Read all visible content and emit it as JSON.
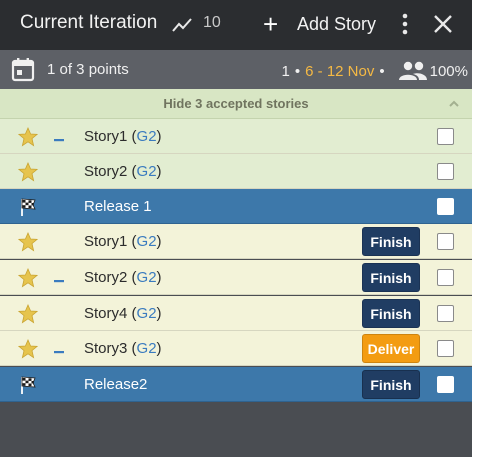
{
  "header": {
    "title": "Current Iteration",
    "velocity": "10",
    "add_story_label": "Add Story",
    "icons": {
      "velocity": "trend-line-icon",
      "add": "plus-icon",
      "more": "more-vertical-icon",
      "close": "close-icon"
    }
  },
  "subheader": {
    "points": "1 of 3 points",
    "iteration_number": "1",
    "separator": "•",
    "dates": "6 - 12 Nov",
    "team_strength": "100%",
    "icons": {
      "calendar": "calendar-icon",
      "team": "team-icon"
    }
  },
  "accepted_bar": {
    "label": "Hide 3 accepted stories"
  },
  "colors": {
    "header_bg": "#2b2d30",
    "subheader_bg": "#5d6066",
    "accepted_bg": "#e2edd1",
    "current_bg": "#f3f3d9",
    "release_bg": "#3d78aa",
    "finish_button": "#203d63",
    "deliver_button": "#f39c12",
    "date_accent": "#f5b944",
    "label_link": "#3a7bbf"
  },
  "stories": [
    {
      "type": "feature",
      "state": "accepted",
      "title": "Story1",
      "label": "G2",
      "has_estimate_mark": true,
      "action": ""
    },
    {
      "type": "feature",
      "state": "accepted",
      "title": "Story2",
      "label": "G2",
      "has_estimate_mark": false,
      "action": ""
    },
    {
      "type": "release",
      "state": "accepted",
      "title": "Release 1",
      "label": "",
      "has_estimate_mark": false,
      "action": ""
    },
    {
      "type": "feature",
      "state": "current",
      "title": "Story1",
      "label": "G2",
      "has_estimate_mark": false,
      "action": "Finish"
    },
    {
      "type": "feature",
      "state": "current",
      "title": "Story2",
      "label": "G2",
      "has_estimate_mark": true,
      "action": "Finish"
    },
    {
      "type": "feature",
      "state": "current",
      "title": "Story4",
      "label": "G2",
      "has_estimate_mark": false,
      "action": "Finish"
    },
    {
      "type": "feature",
      "state": "current",
      "title": "Story3",
      "label": "G2",
      "has_estimate_mark": true,
      "action": "Deliver"
    },
    {
      "type": "release",
      "state": "current",
      "title": "Release2",
      "label": "",
      "has_estimate_mark": false,
      "action": "Finish"
    }
  ]
}
